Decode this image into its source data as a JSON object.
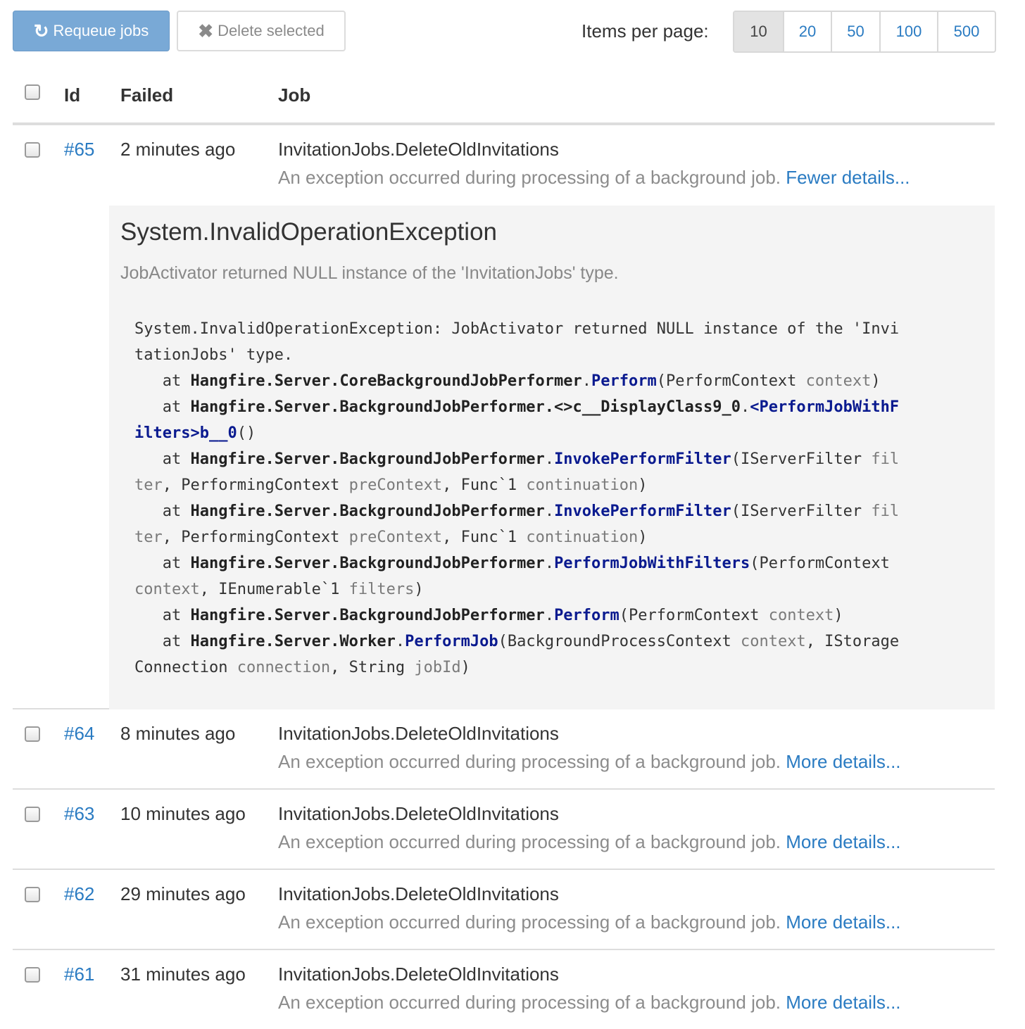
{
  "toolbar": {
    "requeue_label": "Requeue jobs",
    "requeue_icon": "refresh-icon",
    "delete_label": "Delete selected",
    "delete_icon": "close-icon",
    "items_per_page_label": "Items per page:",
    "page_sizes": [
      "10",
      "20",
      "50",
      "100",
      "500"
    ],
    "selected_page_size": "10"
  },
  "table": {
    "headers": {
      "id": "Id",
      "failed": "Failed",
      "job": "Job"
    },
    "rows": [
      {
        "id": "#65",
        "failed": "2 minutes ago",
        "job": "InvitationJobs.DeleteOldInvitations",
        "message": "An exception occurred during processing of a background job.",
        "toggle": "Fewer details..."
      },
      {
        "id": "#64",
        "failed": "8 minutes ago",
        "job": "InvitationJobs.DeleteOldInvitations",
        "message": "An exception occurred during processing of a background job.",
        "toggle": "More details..."
      },
      {
        "id": "#63",
        "failed": "10 minutes ago",
        "job": "InvitationJobs.DeleteOldInvitations",
        "message": "An exception occurred during processing of a background job.",
        "toggle": "More details..."
      },
      {
        "id": "#62",
        "failed": "29 minutes ago",
        "job": "InvitationJobs.DeleteOldInvitations",
        "message": "An exception occurred during processing of a background job.",
        "toggle": "More details..."
      },
      {
        "id": "#61",
        "failed": "31 minutes ago",
        "job": "InvitationJobs.DeleteOldInvitations",
        "message": "An exception occurred during processing of a background job.",
        "toggle": "More details..."
      }
    ]
  },
  "details": {
    "exception_type": "System.InvalidOperationException",
    "exception_message": "JobActivator returned NULL instance of the 'InvitationJobs' type.",
    "stack_trace": [
      [
        [
          "t",
          "System.InvalidOperationException: JobActivator returned NULL instance of the 'Invi"
        ]
      ],
      [
        [
          "t",
          "tationJobs' type."
        ]
      ],
      [
        [
          "t",
          "   at "
        ],
        [
          "b",
          "Hangfire.Server.CoreBackgroundJobPerformer"
        ],
        [
          "t",
          "."
        ],
        [
          "m",
          "Perform"
        ],
        [
          "t",
          "(PerformContext "
        ],
        [
          "p",
          "context"
        ],
        [
          "t",
          ")"
        ]
      ],
      [
        [
          "t",
          "   at "
        ],
        [
          "b",
          "Hangfire.Server.BackgroundJobPerformer.<>c__DisplayClass9_0"
        ],
        [
          "t",
          "."
        ],
        [
          "m",
          "<PerformJobWithF"
        ]
      ],
      [
        [
          "m",
          "ilters>b__0"
        ],
        [
          "t",
          "()"
        ]
      ],
      [
        [
          "t",
          "   at "
        ],
        [
          "b",
          "Hangfire.Server.BackgroundJobPerformer"
        ],
        [
          "t",
          "."
        ],
        [
          "m",
          "InvokePerformFilter"
        ],
        [
          "t",
          "(IServerFilter "
        ],
        [
          "p",
          "fil"
        ]
      ],
      [
        [
          "p",
          "ter"
        ],
        [
          "t",
          ", PerformingContext "
        ],
        [
          "p",
          "preContext"
        ],
        [
          "t",
          ", Func`1 "
        ],
        [
          "p",
          "continuation"
        ],
        [
          "t",
          ")"
        ]
      ],
      [
        [
          "t",
          "   at "
        ],
        [
          "b",
          "Hangfire.Server.BackgroundJobPerformer"
        ],
        [
          "t",
          "."
        ],
        [
          "m",
          "InvokePerformFilter"
        ],
        [
          "t",
          "(IServerFilter "
        ],
        [
          "p",
          "fil"
        ]
      ],
      [
        [
          "p",
          "ter"
        ],
        [
          "t",
          ", PerformingContext "
        ],
        [
          "p",
          "preContext"
        ],
        [
          "t",
          ", Func`1 "
        ],
        [
          "p",
          "continuation"
        ],
        [
          "t",
          ")"
        ]
      ],
      [
        [
          "t",
          "   at "
        ],
        [
          "b",
          "Hangfire.Server.BackgroundJobPerformer"
        ],
        [
          "t",
          "."
        ],
        [
          "m",
          "PerformJobWithFilters"
        ],
        [
          "t",
          "(PerformContext"
        ]
      ],
      [
        [
          "p",
          "context"
        ],
        [
          "t",
          ", IEnumerable`1 "
        ],
        [
          "p",
          "filters"
        ],
        [
          "t",
          ")"
        ]
      ],
      [
        [
          "t",
          "   at "
        ],
        [
          "b",
          "Hangfire.Server.BackgroundJobPerformer"
        ],
        [
          "t",
          "."
        ],
        [
          "m",
          "Perform"
        ],
        [
          "t",
          "(PerformContext "
        ],
        [
          "p",
          "context"
        ],
        [
          "t",
          ")"
        ]
      ],
      [
        [
          "t",
          "   at "
        ],
        [
          "b",
          "Hangfire.Server.Worker"
        ],
        [
          "t",
          "."
        ],
        [
          "m",
          "PerformJob"
        ],
        [
          "t",
          "(BackgroundProcessContext "
        ],
        [
          "p",
          "context"
        ],
        [
          "t",
          ", IStorage"
        ]
      ],
      [
        [
          "t",
          "Connection "
        ],
        [
          "p",
          "connection"
        ],
        [
          "t",
          ", String "
        ],
        [
          "p",
          "jobId"
        ],
        [
          "t",
          ")"
        ]
      ]
    ]
  }
}
